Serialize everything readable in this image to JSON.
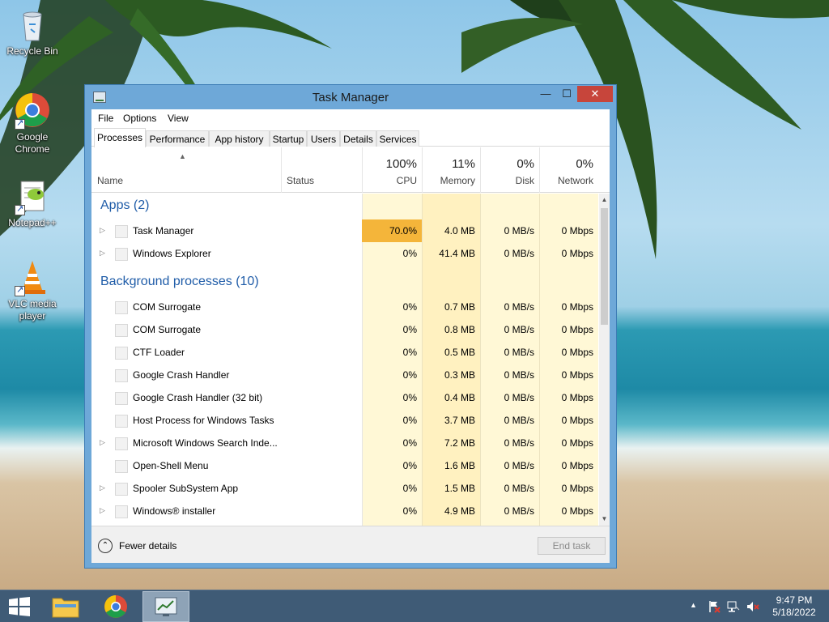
{
  "desktop": {
    "icons": [
      {
        "label": "Recycle Bin"
      },
      {
        "label": "Google Chrome"
      },
      {
        "label": "Notepad++"
      },
      {
        "label": "VLC media player"
      }
    ]
  },
  "window": {
    "title": "Task Manager",
    "buttons": {
      "minimize": "—",
      "maximize": "☐",
      "close": "✕"
    },
    "menu": [
      "File",
      "Options",
      "View"
    ],
    "tabs": [
      "Processes",
      "Performance",
      "App history",
      "Startup",
      "Users",
      "Details",
      "Services"
    ],
    "active_tab": "Processes",
    "columns": {
      "name": "Name",
      "status": "Status",
      "cpu": {
        "percent": "100%",
        "label": "CPU"
      },
      "memory": {
        "percent": "11%",
        "label": "Memory"
      },
      "disk": {
        "percent": "0%",
        "label": "Disk"
      },
      "network": {
        "percent": "0%",
        "label": "Network"
      }
    },
    "groups": [
      {
        "title": "Apps (2)",
        "rows": [
          {
            "name": "Task Manager",
            "expandable": true,
            "cpu": "70.0%",
            "memory": "4.0 MB",
            "disk": "0 MB/s",
            "network": "0 Mbps",
            "hot": true
          },
          {
            "name": "Windows Explorer",
            "expandable": true,
            "cpu": "0%",
            "memory": "41.4 MB",
            "disk": "0 MB/s",
            "network": "0 Mbps"
          }
        ]
      },
      {
        "title": "Background processes (10)",
        "rows": [
          {
            "name": "COM Surrogate",
            "expandable": false,
            "cpu": "0%",
            "memory": "0.7 MB",
            "disk": "0 MB/s",
            "network": "0 Mbps"
          },
          {
            "name": "COM Surrogate",
            "expandable": false,
            "cpu": "0%",
            "memory": "0.8 MB",
            "disk": "0 MB/s",
            "network": "0 Mbps"
          },
          {
            "name": "CTF Loader",
            "expandable": false,
            "cpu": "0%",
            "memory": "0.5 MB",
            "disk": "0 MB/s",
            "network": "0 Mbps"
          },
          {
            "name": "Google Crash Handler",
            "expandable": false,
            "cpu": "0%",
            "memory": "0.3 MB",
            "disk": "0 MB/s",
            "network": "0 Mbps"
          },
          {
            "name": "Google Crash Handler (32 bit)",
            "expandable": false,
            "cpu": "0%",
            "memory": "0.4 MB",
            "disk": "0 MB/s",
            "network": "0 Mbps"
          },
          {
            "name": "Host Process for Windows Tasks",
            "expandable": false,
            "cpu": "0%",
            "memory": "3.7 MB",
            "disk": "0 MB/s",
            "network": "0 Mbps"
          },
          {
            "name": "Microsoft Windows Search Inde...",
            "expandable": true,
            "cpu": "0%",
            "memory": "7.2 MB",
            "disk": "0 MB/s",
            "network": "0 Mbps"
          },
          {
            "name": "Open-Shell Menu",
            "expandable": false,
            "cpu": "0%",
            "memory": "1.6 MB",
            "disk": "0 MB/s",
            "network": "0 Mbps"
          },
          {
            "name": "Spooler SubSystem App",
            "expandable": true,
            "cpu": "0%",
            "memory": "1.5 MB",
            "disk": "0 MB/s",
            "network": "0 Mbps"
          },
          {
            "name": "Windows® installer",
            "expandable": true,
            "cpu": "0%",
            "memory": "4.9 MB",
            "disk": "0 MB/s",
            "network": "0 Mbps"
          }
        ]
      }
    ],
    "footer": {
      "fewer_details": "Fewer details",
      "end_task": "End task"
    }
  },
  "taskbar": {
    "clock_time": "9:47 PM",
    "clock_date": "5/18/2022"
  },
  "colors": {
    "cpu_hot": "#f4b53a",
    "column_tint": "#fff4c4",
    "group_title": "#1f5ca8",
    "taskbar": "#3f5b76"
  }
}
